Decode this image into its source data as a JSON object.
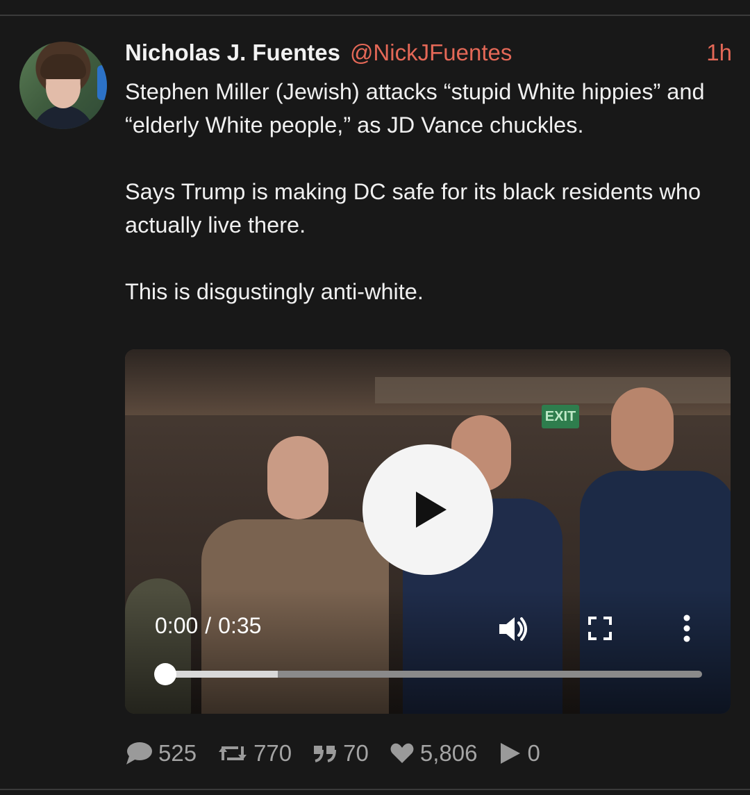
{
  "post": {
    "author_name": "Nicholas J. Fuentes",
    "author_handle": "@NickJFuentes",
    "time": "1h",
    "paragraphs": [
      "Stephen Miller (Jewish) attacks “stupid White hippies” and “elderly White people,” as JD Vance chuckles.",
      "Says Trump is making DC safe for its black residents who actually live there.",
      "This is disgustingly anti-white."
    ]
  },
  "video": {
    "current_time": "0:00",
    "separator": "/",
    "duration": "0:35",
    "buffered_fraction": 0.21,
    "played_fraction": 0.0,
    "scene_sign": "EXIT"
  },
  "actions": {
    "replies": "525",
    "reposts": "770",
    "quotes": "70",
    "likes": "5,806",
    "views": "0"
  },
  "colors": {
    "background": "#181818",
    "accent": "#e46857",
    "text": "#f0f0f0",
    "muted": "#9a9a9a"
  },
  "icons": {
    "reply": "speech-bubble-icon",
    "repost": "repost-icon",
    "quote": "quote-icon",
    "like": "heart-icon",
    "views": "play-triangle-icon",
    "play": "play-icon",
    "volume": "volume-icon",
    "fullscreen": "fullscreen-icon",
    "more": "more-vertical-icon"
  }
}
